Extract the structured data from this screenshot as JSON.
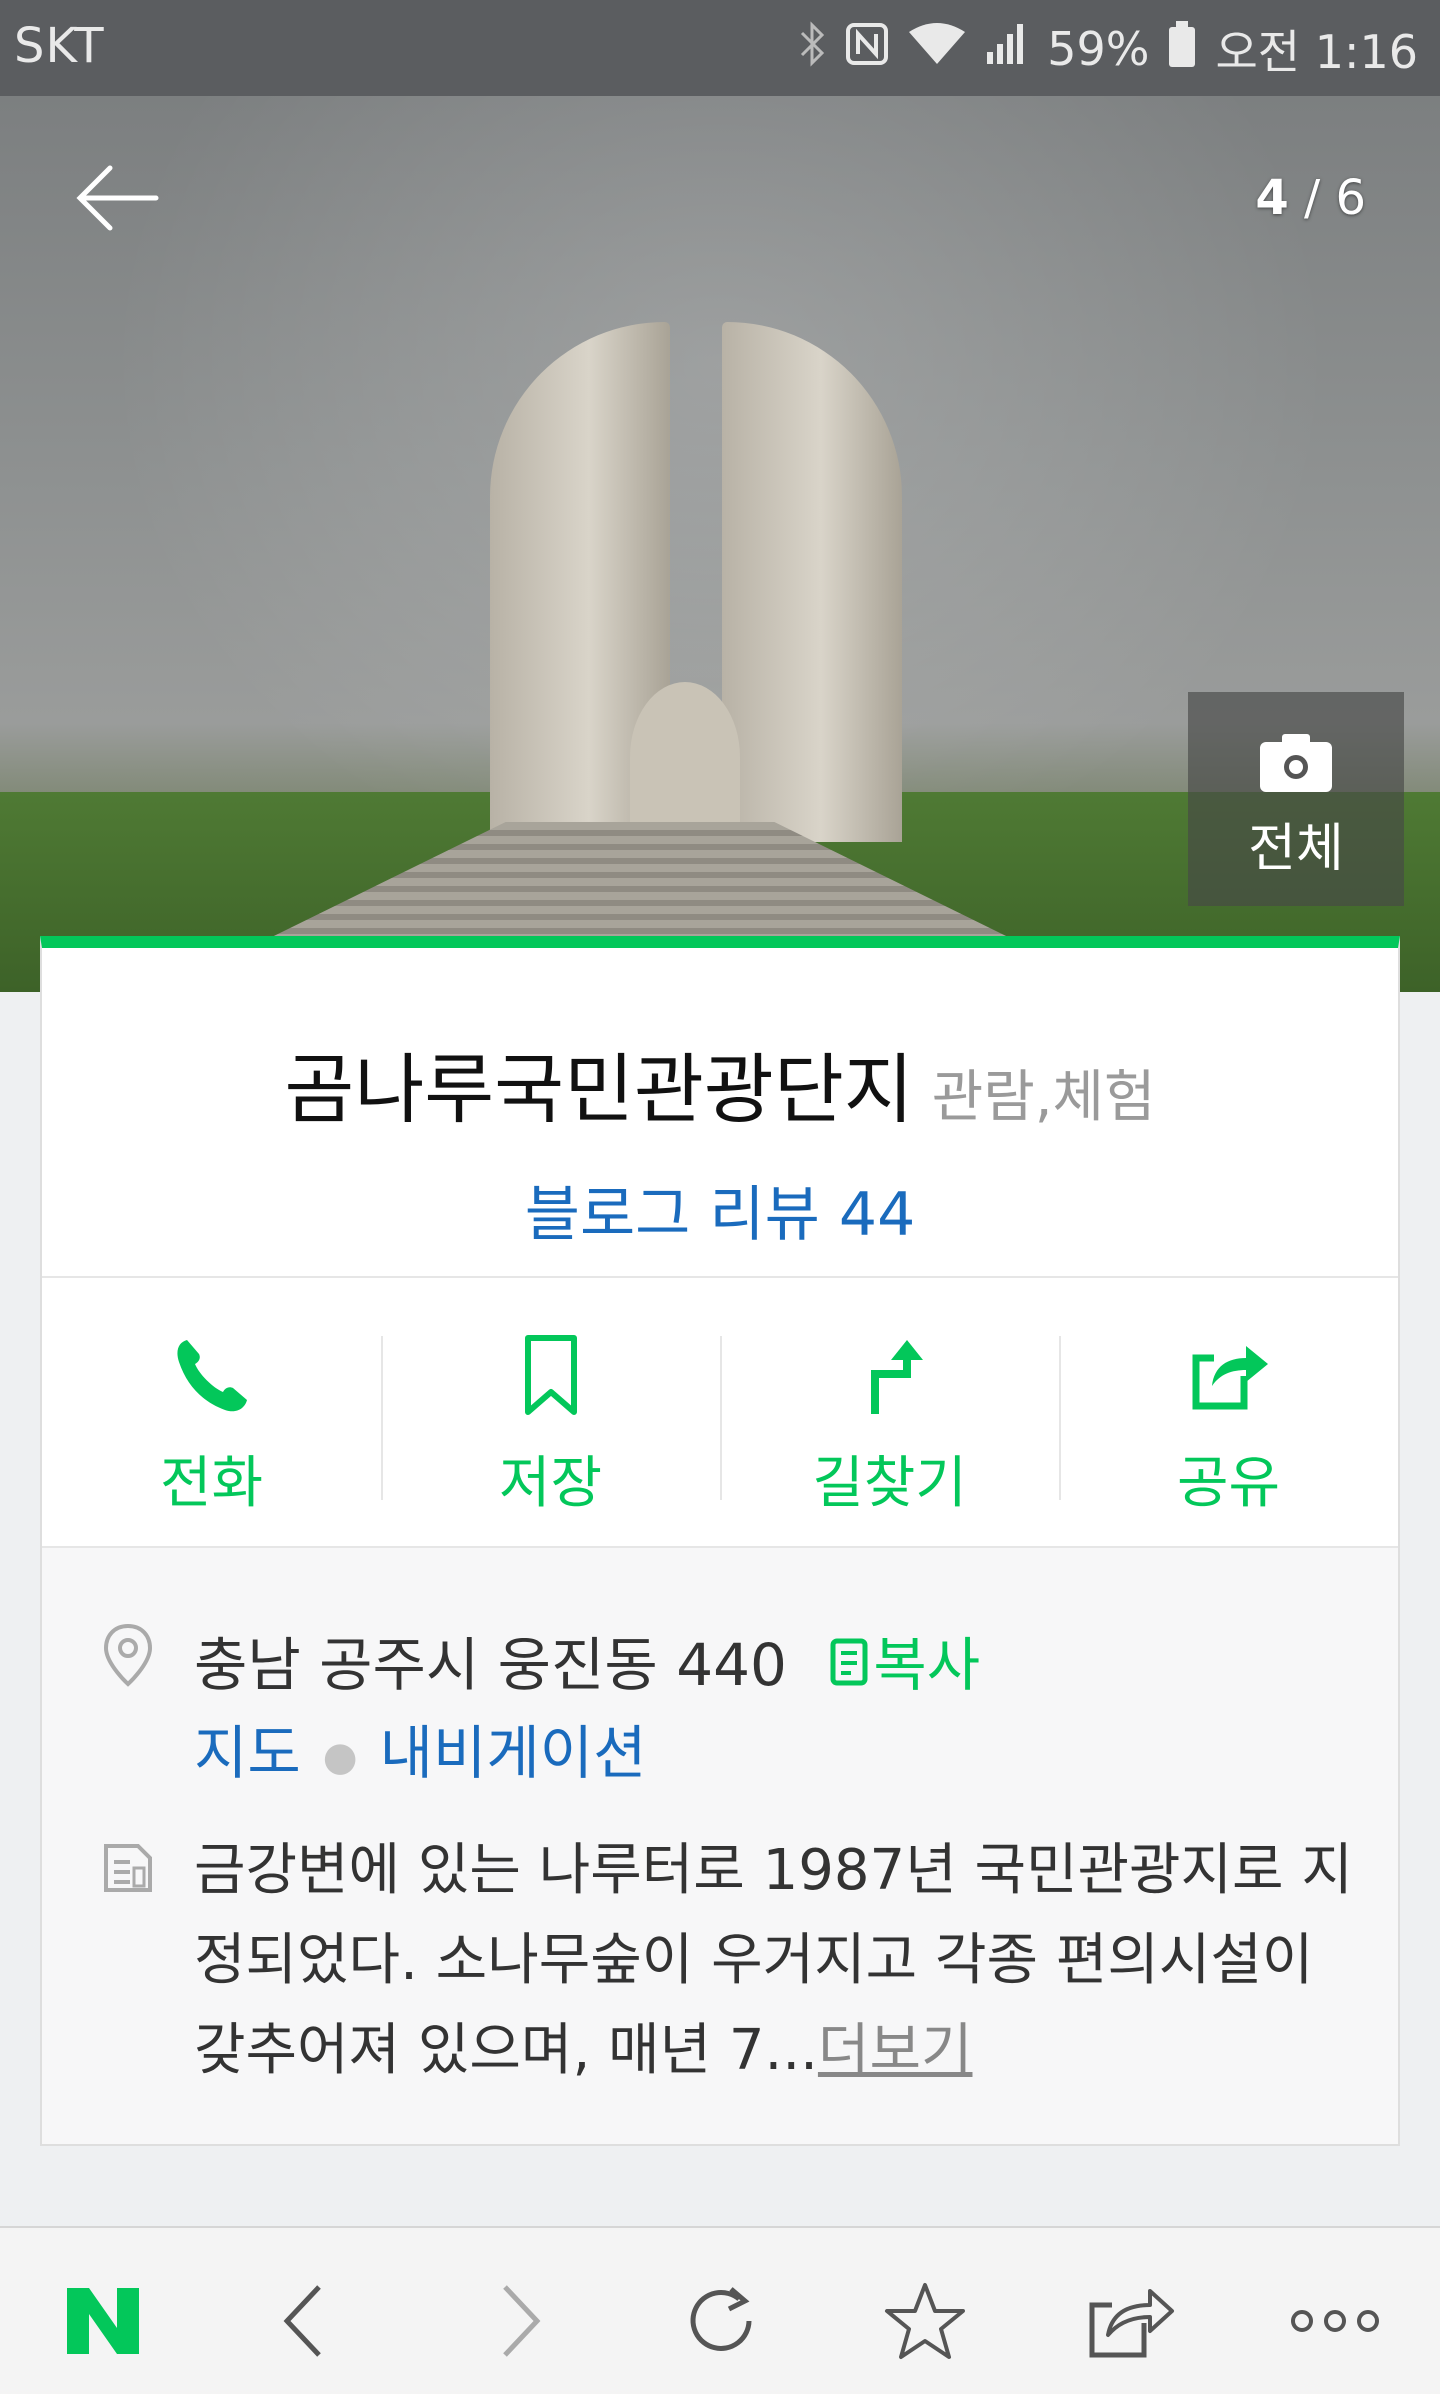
{
  "status_bar": {
    "carrier": "SKT",
    "battery": "59%",
    "time": "오전 1:16",
    "icons": [
      "bluetooth-icon",
      "nfc-icon",
      "wifi-icon",
      "signal-icon",
      "battery-icon"
    ]
  },
  "gallery": {
    "current": "4",
    "separator": "/",
    "total": "6",
    "all_label": "전체"
  },
  "place": {
    "name": "곰나루국민관광단지",
    "category": "관람,체험",
    "review_link": "블로그 리뷰 44"
  },
  "actions": [
    {
      "label": "전화",
      "icon": "phone-icon"
    },
    {
      "label": "저장",
      "icon": "bookmark-icon"
    },
    {
      "label": "길찾기",
      "icon": "directions-icon"
    },
    {
      "label": "공유",
      "icon": "share-icon"
    }
  ],
  "info": {
    "address": "충남 공주시 웅진동 440",
    "copy_label": "복사",
    "map_link": "지도",
    "nav_link": "내비게이션",
    "description": "금강변에 있는 나루터로 1987년 국민관광지로 지정되었다. 소나무숲이 우거지고 각종 편의시설이 갖추어져 있으며, 매년 7...",
    "more_label": "더보기"
  },
  "colors": {
    "accent": "#03c75a",
    "link": "#1a6bbd"
  }
}
